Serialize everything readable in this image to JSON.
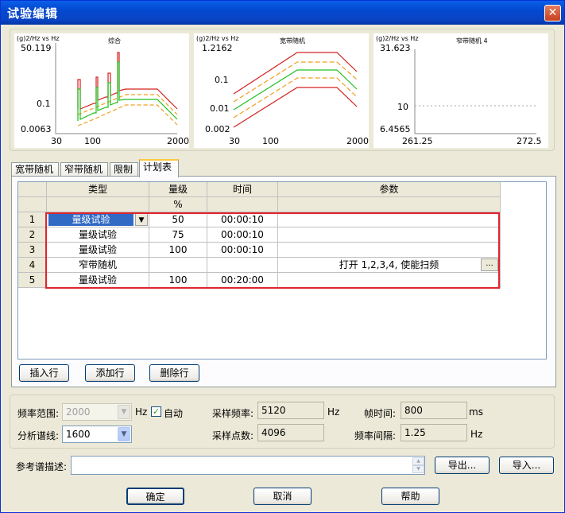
{
  "window": {
    "title": "试验编辑",
    "close_glyph": "✕"
  },
  "charts": [
    {
      "ylabel": "(g)2/Hz vs Hz",
      "title": "综合",
      "y_ticks": [
        "50.119",
        "0.1",
        "0.0063"
      ],
      "x_ticks": [
        "30",
        "100",
        "2000"
      ]
    },
    {
      "ylabel": "(g)2/Hz vs Hz",
      "title": "宽带随机",
      "y_ticks": [
        "1.2162",
        "0.1",
        "0.01",
        "0.002"
      ],
      "x_ticks": [
        "30",
        "100",
        "2000"
      ]
    },
    {
      "ylabel": "(g)2/Hz vs Hz",
      "title": "窄带随机 4",
      "y_ticks": [
        "31.623",
        "10",
        "6.4565"
      ],
      "x_ticks": [
        "261.25",
        "272.5"
      ]
    }
  ],
  "tabs": [
    "宽带随机",
    "窄带随机",
    "限制",
    "计划表"
  ],
  "active_tab": "计划表",
  "schedule": {
    "columns": [
      "类型",
      "量级",
      "时间",
      "参数"
    ],
    "units": [
      "",
      "%",
      "",
      ""
    ],
    "rows": [
      {
        "num": "1",
        "type": "量级试验",
        "level": "50",
        "time": "00:00:10",
        "params": ""
      },
      {
        "num": "2",
        "type": "量级试验",
        "level": "75",
        "time": "00:00:10",
        "params": ""
      },
      {
        "num": "3",
        "type": "量级试验",
        "level": "100",
        "time": "00:00:10",
        "params": ""
      },
      {
        "num": "4",
        "type": "窄带随机",
        "level": "",
        "time": "",
        "params": "打开 1,2,3,4, 使能扫频"
      },
      {
        "num": "5",
        "type": "量级试验",
        "level": "100",
        "time": "00:20:00",
        "params": ""
      }
    ],
    "dots_label": "...",
    "insert_label": "插入行",
    "add_label": "添加行",
    "delete_label": "删除行"
  },
  "settings": {
    "freq_range_label": "频率范围:",
    "freq_range_value": "2000",
    "hz": "Hz",
    "auto_label": "自动",
    "auto_checked": true,
    "lines_label": "分析谱线:",
    "lines_value": "1600",
    "sample_rate_label": "采样频率:",
    "sample_rate_value": "5120",
    "sample_points_label": "采样点数:",
    "sample_points_value": "4096",
    "frame_time_label": "帧时间:",
    "frame_time_value": "800",
    "ms": "ms",
    "freq_interval_label": "频率间隔:",
    "freq_interval_value": "1.25"
  },
  "reference": {
    "label": "参考谱描述:",
    "value": "",
    "export_label": "导出...",
    "import_label": "导入..."
  },
  "footer": {
    "ok_label": "确定",
    "cancel_label": "取消",
    "help_label": "帮助"
  },
  "colors": {
    "abort": "#D42020",
    "alarm": "#F0A020",
    "reference": "#20C020",
    "highlight": "#E0242E"
  }
}
